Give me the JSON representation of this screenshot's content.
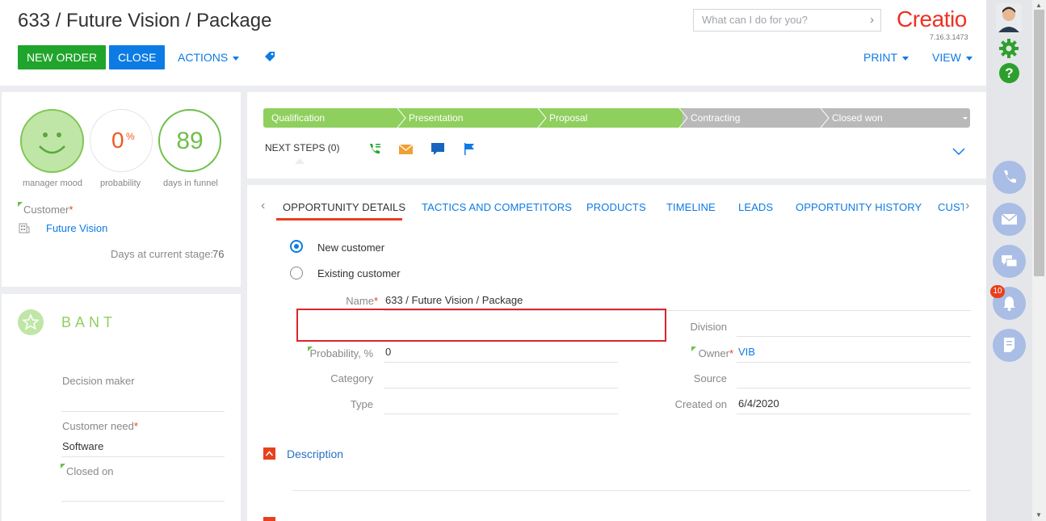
{
  "header": {
    "title": "633 / Future Vision / Package",
    "new_order": "NEW ORDER",
    "close": "CLOSE",
    "actions": "ACTIONS",
    "print": "PRINT",
    "view": "VIEW",
    "search_placeholder": "What can I do for you?",
    "logo": "Creatio",
    "version": "7.16.3.1473"
  },
  "indicators": {
    "mood_label": "manager mood",
    "probability_value": "0",
    "probability_unit": "%",
    "probability_label": "probability",
    "days_value": "89",
    "days_label": "days in funnel"
  },
  "customer": {
    "label": "Customer",
    "value": "Future Vision",
    "days_stage_label": "Days at current stage:",
    "days_stage_value": "76"
  },
  "bant": {
    "title": "BANT",
    "decision_maker": "Decision maker",
    "customer_need": "Customer need",
    "customer_need_value": "Software",
    "closed_on": "Closed on"
  },
  "stages": [
    "Qualification",
    "Presentation",
    "Proposal",
    "Contracting",
    "Closed won"
  ],
  "next_steps": "NEXT STEPS (0)",
  "tabs": [
    "OPPORTUNITY DETAILS",
    "TACTICS AND COMPETITORS",
    "PRODUCTS",
    "TIMELINE",
    "LEADS",
    "OPPORTUNITY HISTORY",
    "CUST"
  ],
  "details": {
    "new_customer": "New customer",
    "existing_customer": "Existing customer",
    "name_label": "Name",
    "name_value": "633 / Future Vision / Package",
    "division_label": "Division",
    "probability_label": "Probability, %",
    "probability_value": "0",
    "owner_label": "Owner",
    "owner_value": "VIB",
    "category_label": "Category",
    "source_label": "Source",
    "type_label": "Type",
    "created_label": "Created on",
    "created_value": "6/4/2020",
    "description": "Description"
  },
  "notifications_count": "10",
  "colors": {
    "primary_blue": "#0d7be4",
    "green": "#20a52c",
    "stage_green": "#8fcf5e",
    "stage_grey": "#b9b9b9",
    "accent_red": "#e8401b"
  }
}
